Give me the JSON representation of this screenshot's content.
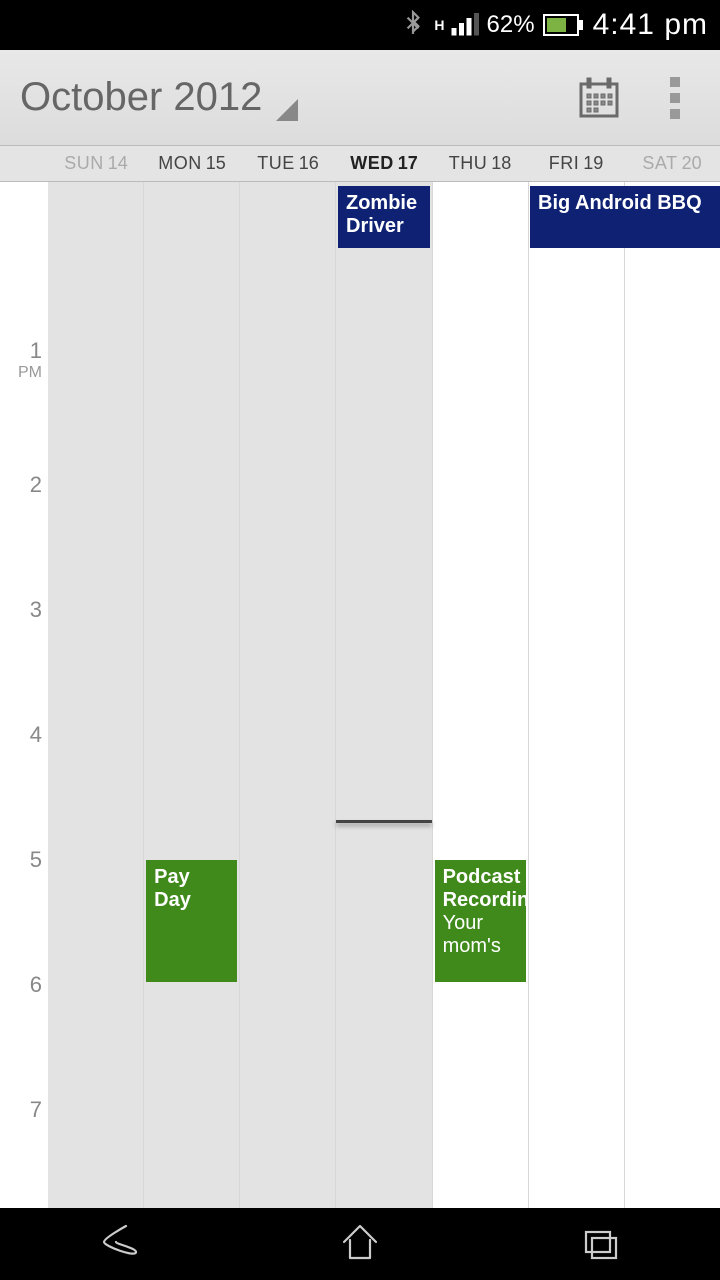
{
  "status": {
    "network_indicator": "H",
    "battery_percent": "62%",
    "time": "4:41 pm"
  },
  "header": {
    "title": "October 2012"
  },
  "days": [
    {
      "dow": "SUN",
      "num": "14",
      "dim": true
    },
    {
      "dow": "MON",
      "num": "15"
    },
    {
      "dow": "TUE",
      "num": "16"
    },
    {
      "dow": "WED",
      "num": "17",
      "today": true
    },
    {
      "dow": "THU",
      "num": "18"
    },
    {
      "dow": "FRI",
      "num": "19"
    },
    {
      "dow": "SAT",
      "num": "20",
      "dim": true
    }
  ],
  "hours": {
    "h1": "1",
    "pm": "PM",
    "h2": "2",
    "h3": "3",
    "h4": "4",
    "h5": "5",
    "h6": "6",
    "h7": "7"
  },
  "allday_events": {
    "zombie": "Zombie Driver",
    "bbq": "Big Android BBQ"
  },
  "events": {
    "payday": {
      "title": "Pay Day"
    },
    "podcast": {
      "title": "Podcast Recording",
      "detail": "Your mom's"
    }
  },
  "colors": {
    "allday": "#0f2173",
    "event": "#3f8a1b"
  }
}
